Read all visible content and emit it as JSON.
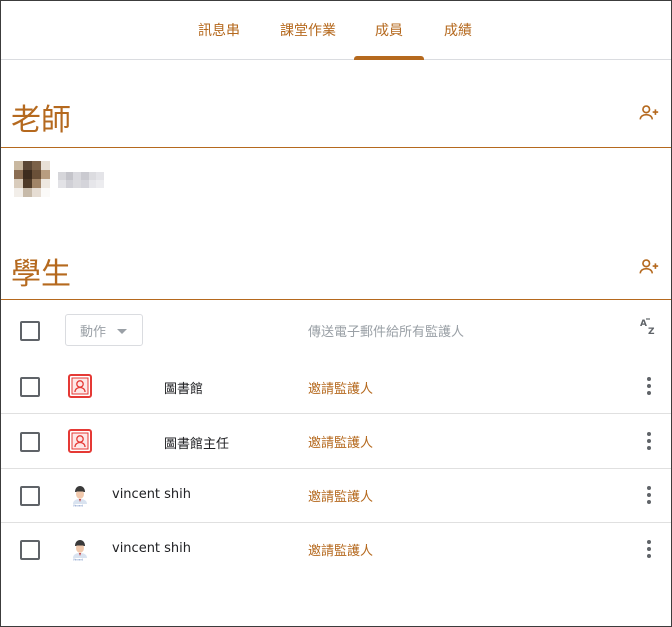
{
  "tabs": [
    {
      "label": "訊息串",
      "active": false
    },
    {
      "label": "課堂作業",
      "active": false
    },
    {
      "label": "成員",
      "active": true
    },
    {
      "label": "成績",
      "active": false
    }
  ],
  "teachers": {
    "title": "老師",
    "add_icon": "person-add-icon"
  },
  "students": {
    "title": "學生",
    "add_icon": "person-add-icon",
    "actions_label": "動作",
    "email_guardians_label": "傳送電子郵件給所有監護人",
    "sort_icon": "sort-az-icon",
    "sort_label": "AZ",
    "rows": [
      {
        "name": "圖書館",
        "invite": "邀請監護人",
        "avatar": "badge-avatar"
      },
      {
        "name": "圖書館主任",
        "invite": "邀請監護人",
        "avatar": "badge-avatar"
      },
      {
        "name": "vincent shih",
        "invite": "邀請監護人",
        "avatar": "person-photo-avatar"
      },
      {
        "name": "vincent shih",
        "invite": "邀請監護人",
        "avatar": "person-photo-avatar"
      }
    ]
  },
  "colors": {
    "accent": "#b5691e",
    "muted": "#9aa0a6",
    "text": "#202124",
    "divider": "#e0e0e0"
  }
}
